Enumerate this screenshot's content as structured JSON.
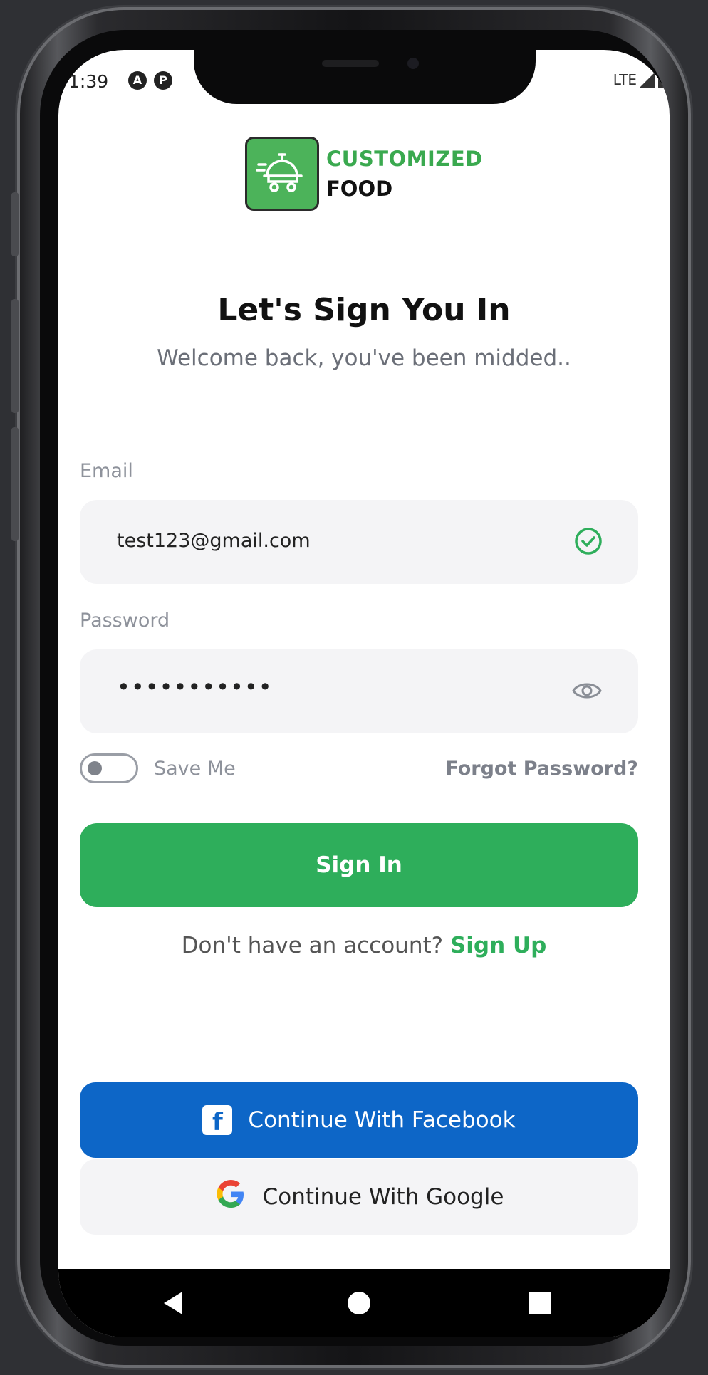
{
  "status_bar": {
    "time": "1:39",
    "icon1": "A",
    "icon2": "P",
    "network": "LTE"
  },
  "brand": {
    "line1": "CUSTOMIZED",
    "line2": "FOOD",
    "logo_icon": "food-cart-icon"
  },
  "heading": {
    "title": "Let's Sign You In",
    "subtitle": "Welcome back, you've been midded.."
  },
  "form": {
    "email_label": "Email",
    "email_value": "test123@gmail.com",
    "password_label": "Password",
    "password_value": "•••••••••••",
    "save_me_label": "Save Me",
    "save_me_on": false,
    "forgot_label": "Forgot Password?"
  },
  "actions": {
    "sign_in_label": "Sign In",
    "no_account_text": "Don't have an account?",
    "sign_up_label": "Sign Up",
    "facebook_label": "Continue With Facebook",
    "google_label": "Continue With Google"
  },
  "colors": {
    "primary": "#2eae5b",
    "facebook": "#0d66c7",
    "field_bg": "#f4f4f6"
  }
}
